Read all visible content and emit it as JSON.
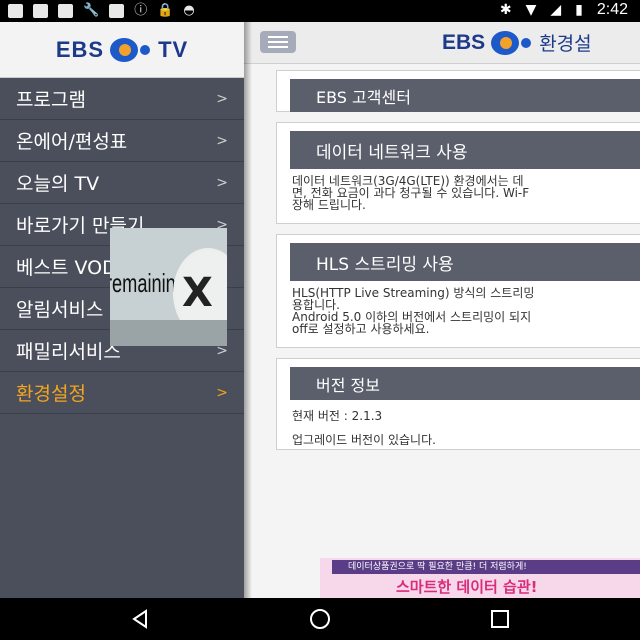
{
  "status_bar": {
    "time": "2:42",
    "icons": [
      "flipboard-icon",
      "flipboard-icon",
      "flipboard-icon",
      "wrench-icon",
      "flipboard-icon",
      "info-icon",
      "lock-icon",
      "android-icon",
      "bluetooth-icon",
      "wifi-icon",
      "no-signal-icon",
      "battery-icon"
    ]
  },
  "drawer": {
    "logo": {
      "brand": "EBS",
      "suffix": "TV"
    },
    "items": [
      {
        "label": "프로그램",
        "chevron": ">"
      },
      {
        "label": "온에어/편성표",
        "chevron": ">"
      },
      {
        "label": "오늘의 TV",
        "chevron": ">"
      },
      {
        "label": "바로가기 만들기",
        "chevron": ">"
      },
      {
        "label": "베스트 VOD",
        "chevron": ">"
      },
      {
        "label": "알림서비스",
        "chevron": ">"
      },
      {
        "label": "패밀리서비스",
        "chevron": ">"
      },
      {
        "label": "환경설정",
        "chevron": ">",
        "active": true
      }
    ]
  },
  "overlay_ad": {
    "text": "remaining",
    "close": "X"
  },
  "topbar": {
    "brand": "EBS",
    "title": "환경설"
  },
  "cards": [
    {
      "title": "EBS 고객센터"
    },
    {
      "title": "데이터 네트워크 사용",
      "lines": [
        "데이터 네트워크(3G/4G(LTE)) 환경에서는 데",
        "면, 전화 요금이 과다 청구될 수 있습니다. Wi-F",
        "장해 드립니다."
      ]
    },
    {
      "title": "HLS 스트리밍 사용",
      "lines": [
        "HLS(HTTP Live Streaming) 방식의 스트리밍",
        "용합니다.",
        "Android 5.0 이하의 버전에서 스트리밍이 되지",
        "off로 설정하고 사용하세요."
      ]
    },
    {
      "title": "버전 정보",
      "version": "현재 버전 : 2.1.3",
      "upgrade": "업그레이드 버전이 있습니다."
    }
  ],
  "bottom_ad": {
    "strip": "데이터상품권으로 딱 필요한 만큼! 더 저렴하게!",
    "headline": "스마트한 데이터 습관!"
  },
  "colors": {
    "drawer_bg": "#4a4f5b",
    "active": "#f3a51f",
    "brand_blue": "#1d3a8a",
    "card_title_bg": "#5a5f6b"
  }
}
